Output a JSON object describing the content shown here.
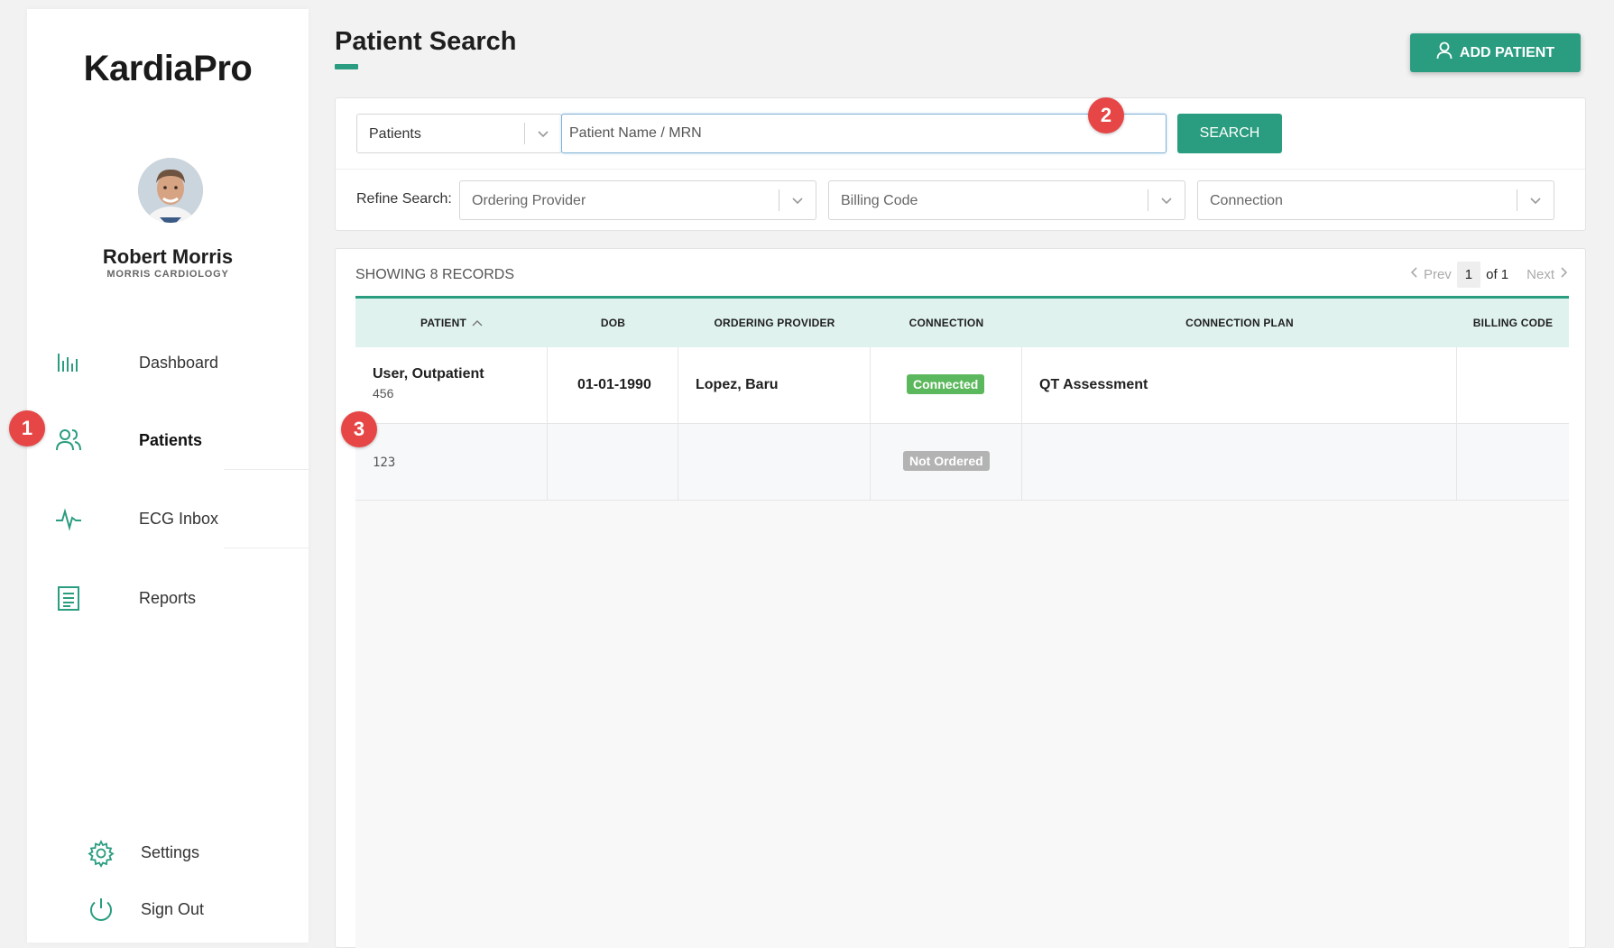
{
  "app": {
    "logo": "KardiaPro"
  },
  "user": {
    "name": "Robert Morris",
    "org": "MORRIS CARDIOLOGY"
  },
  "sidebar": {
    "items": [
      {
        "label": "Dashboard",
        "icon": "bar-chart-icon"
      },
      {
        "label": "Patients",
        "icon": "users-icon",
        "active": true
      },
      {
        "label": "ECG Inbox",
        "icon": "ecg-pulse-icon"
      },
      {
        "label": "Reports",
        "icon": "document-icon"
      }
    ],
    "bottom": [
      {
        "label": "Settings",
        "icon": "gear-icon"
      },
      {
        "label": "Sign Out",
        "icon": "power-icon"
      }
    ]
  },
  "header": {
    "title": "Patient Search",
    "add_patient_label": "ADD PATIENT"
  },
  "search": {
    "scope_value": "Patients",
    "placeholder": "Patient Name / MRN",
    "button_label": "SEARCH",
    "refine_label": "Refine Search:",
    "filters": [
      "Ordering Provider",
      "Billing Code",
      "Connection"
    ]
  },
  "results": {
    "count_label": "SHOWING 8 RECORDS",
    "pager": {
      "prev": "Prev",
      "page": "1",
      "of": "of 1",
      "next": "Next"
    },
    "columns": [
      "PATIENT",
      "DOB",
      "ORDERING PROVIDER",
      "CONNECTION",
      "CONNECTION PLAN",
      "BILLING CODE"
    ],
    "rows": [
      {
        "patient": "User, Outpatient",
        "mrn": "456",
        "dob": "01-01-1990",
        "provider": "Lopez, Baru",
        "connection": "Connected",
        "plan": "QT Assessment",
        "billing": ""
      },
      {
        "patient": "",
        "mrn": "123",
        "dob": "",
        "provider": "",
        "connection": "Not Ordered",
        "plan": "",
        "billing": ""
      }
    ]
  },
  "markers": [
    "1",
    "2",
    "3"
  ],
  "colors": {
    "accent": "#2a9d80",
    "header_bg": "#dff2ee",
    "connected": "#5cb85c",
    "not_ordered": "#b3b3b3",
    "marker": "#e64646"
  }
}
